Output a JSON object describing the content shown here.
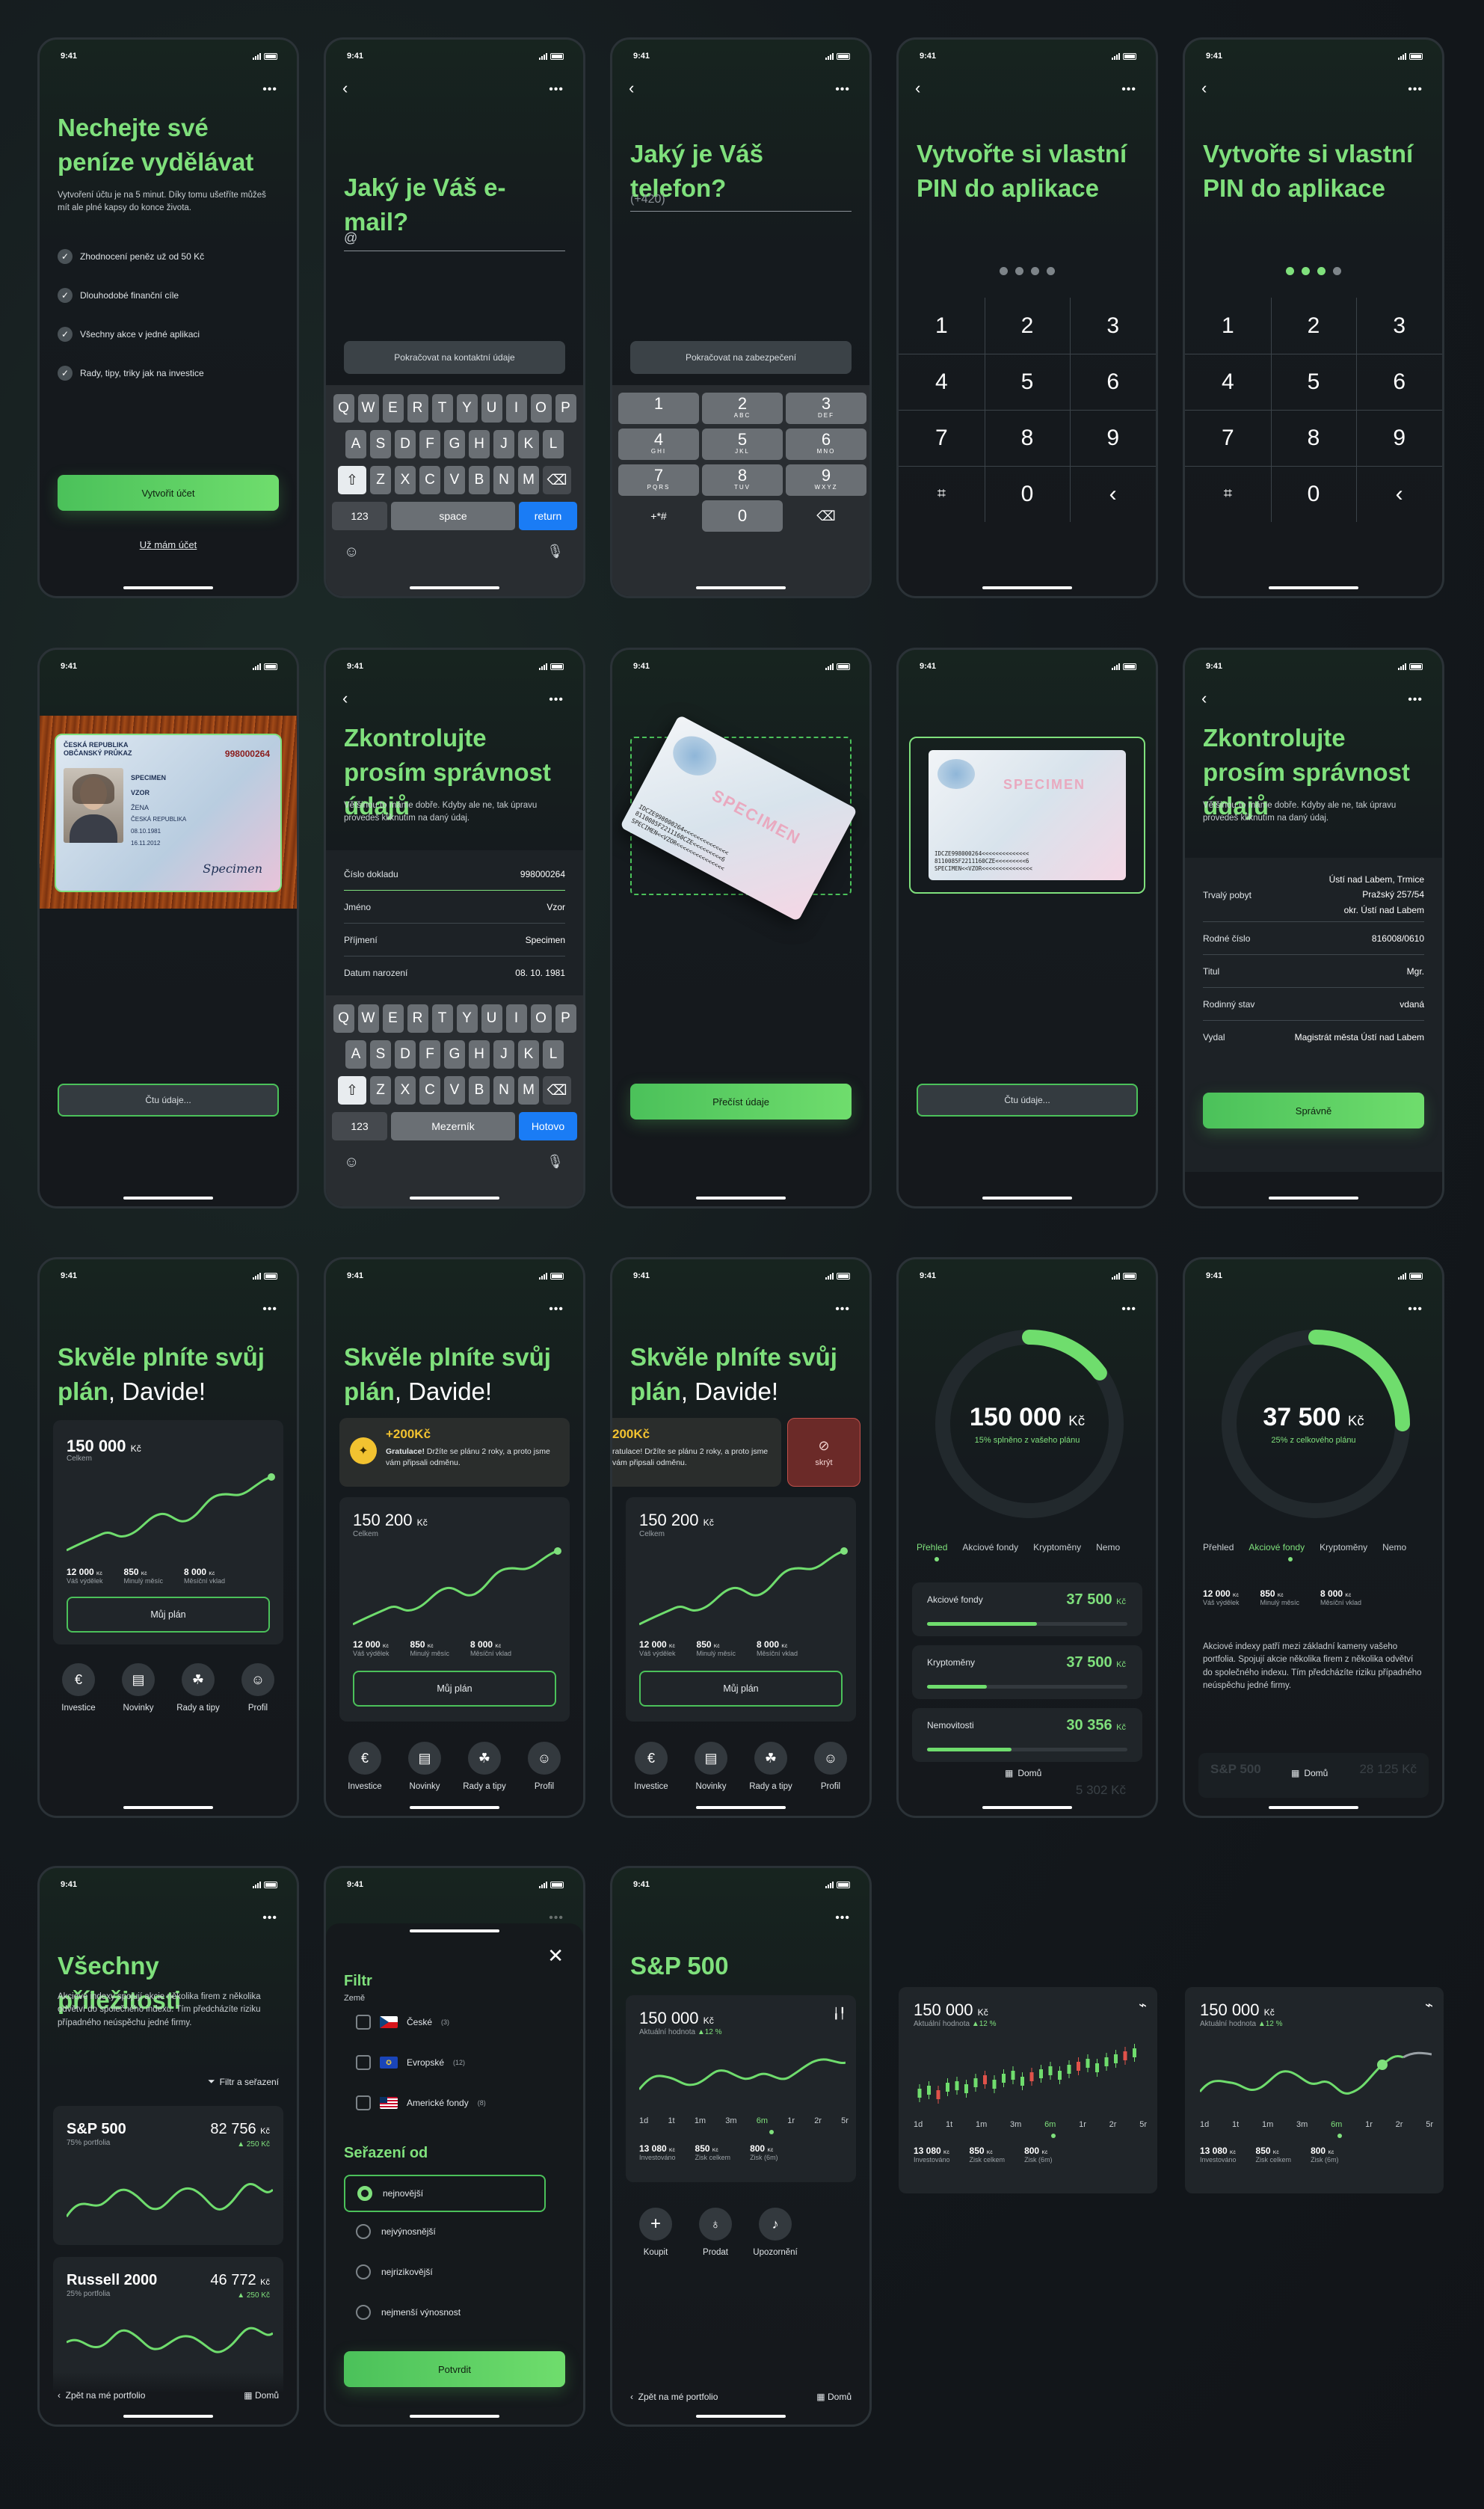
{
  "status_time": "9:41",
  "s1": {
    "title": "Nechejte své peníze vydělávat",
    "subtitle": "Vytvoření účtu je na 5 minut. Díky tomu ušetříte můžeš mít ale plné kapsy do konce života.",
    "bullets": [
      "Zhodnocení peněz už od 50 Kč",
      "Dlouhodobé finanční cíle",
      "Všechny akce v jedné aplikaci",
      "Rady, tipy, triky jak na investice"
    ],
    "primary": "Vytvořit účet",
    "secondary": "Už mám účet"
  },
  "s2": {
    "title": "Jaký je Váš e-mail?",
    "input_prefix": "@",
    "button": "Pokračovat na kontaktní údaje",
    "kb_row1": [
      "Q",
      "W",
      "E",
      "R",
      "T",
      "Y",
      "U",
      "I",
      "O",
      "P"
    ],
    "kb_row2": [
      "A",
      "S",
      "D",
      "F",
      "G",
      "H",
      "J",
      "K",
      "L"
    ],
    "kb_row3": [
      "Z",
      "X",
      "C",
      "V",
      "B",
      "N",
      "M"
    ],
    "kb_123": "123",
    "kb_space": "space",
    "kb_return": "return"
  },
  "s3": {
    "title": "Jaký je Váš telefon?",
    "prefix": "(+420)",
    "button": "Pokračovat na zabezpečení",
    "keys": [
      {
        "n": "1",
        "l": ""
      },
      {
        "n": "2",
        "l": "ABC"
      },
      {
        "n": "3",
        "l": "DEF"
      },
      {
        "n": "4",
        "l": "GHI"
      },
      {
        "n": "5",
        "l": "JKL"
      },
      {
        "n": "6",
        "l": "MNO"
      },
      {
        "n": "7",
        "l": "PQRS"
      },
      {
        "n": "8",
        "l": "TUV"
      },
      {
        "n": "9",
        "l": "WXYZ"
      }
    ],
    "sym": "+*#",
    "zero": "0"
  },
  "s4": {
    "title": "Vytvořte si vlastní PIN do aplikace"
  },
  "s5": {
    "title": "Vytvořte si vlastní PIN do aplikace"
  },
  "pin_keys": [
    "1",
    "2",
    "3",
    "4",
    "5",
    "6",
    "7",
    "8",
    "9",
    "",
    "0",
    "‹"
  ],
  "id_card": {
    "header1": "ČESKÁ REPUBLIKA",
    "header2": "OBČANSKÝ PRŮKAZ",
    "header3": "CZECH REPUBLIC   IDENTIFICATION CARD",
    "number": "998000264",
    "surname": "SPECIMEN",
    "name": "VZOR",
    "sex": "ŽENA",
    "nationality": "ČESKÁ REPUBLIKA",
    "birth": "08.10.1981",
    "issued": "16.11.2012"
  },
  "s6": {
    "button": "Čtu údaje..."
  },
  "s7": {
    "title": "Zkontrolujte prosím správnost údajů",
    "subtitle": "Většinou to máme dobře. Kdyby ale ne, tak úpravu provedeš kliknutím na daný údaj.",
    "fields": [
      {
        "k": "Číslo dokladu",
        "v": "998000264"
      },
      {
        "k": "Jméno",
        "v": "Vzor"
      },
      {
        "k": "Příjmení",
        "v": "Specimen"
      },
      {
        "k": "Datum narození",
        "v": "08. 10. 1981"
      }
    ],
    "kb_mid": "Mezerník",
    "kb_done": "Hotovo"
  },
  "s8": {
    "button": "Přečíst údaje",
    "specimen": "SPECIMEN"
  },
  "mrz": [
    "IDCZE998000264<<<<<<<<<<<<<<",
    "8110085F2211160CZE<<<<<<<<<6",
    "SPECIMEN<<VZOR<<<<<<<<<<<<<<<"
  ],
  "s9": {
    "button": "Čtu údaje..."
  },
  "s10": {
    "title": "Zkontrolujte prosím správnost údajů",
    "subtitle": "Většinou to máme dobře. Kdyby ale ne, tak úpravu provedeš kliknutím na daný údaj.",
    "address_k": "Trvalý pobyt",
    "address_v": [
      "Ústí nad Labem, Trmice",
      "Pražský 257/54",
      "okr. Ústí nad Labem"
    ],
    "fields": [
      {
        "k": "Rodné číslo",
        "v": "816008/0610"
      },
      {
        "k": "Titul",
        "v": "Mgr."
      },
      {
        "k": "Rodinný stav",
        "v": "vdaná"
      },
      {
        "k": "Vydal",
        "v": "Magistrát města Ústí nad Labem"
      }
    ],
    "button": "Správně"
  },
  "plan": {
    "title_g": "Skvěle plníte svůj plán",
    "title_w": ", Davide!",
    "amount1": "150 000",
    "amount2": "150 200",
    "currency": "Kč",
    "total_label": "Celkem",
    "stats": [
      {
        "v": "12 000",
        "u": "Kč",
        "l": "Váš výdělek"
      },
      {
        "v": "850",
        "u": "Kč",
        "l": "Minulý měsíc"
      },
      {
        "v": "8 000",
        "u": "Kč",
        "l": "Měsíční vklad"
      }
    ],
    "plan_btn": "Můj plán",
    "nav": [
      "Investice",
      "Novinky",
      "Rady a tipy",
      "Profil"
    ],
    "reward_title": "+200Kč",
    "reward_text_b": "Gratulace!",
    "reward_text": " Držíte se plánu 2 roky, a proto jsme vám připsali odměnu.",
    "reward_partial": "200Kč",
    "reward_partial_text": "ratulace! Držíte se plánu 2 roky, a proto jsme vám připsali odměnu.",
    "hide": "skrýt"
  },
  "port1": {
    "big": "150 000",
    "cur": "Kč",
    "caption": "15% splněno z vašeho plánu",
    "tabs": [
      "Přehled",
      "Akciové fondy",
      "Kryptoměny",
      "Nemo"
    ],
    "rows": [
      {
        "k": "Akciové fondy",
        "v": "37 500",
        "fill": 0.55
      },
      {
        "k": "Kryptoměny",
        "v": "37 500",
        "fill": 0.3
      },
      {
        "k": "Nemovitosti",
        "v": "30 356",
        "fill": 0.42
      }
    ],
    "home": "Domů",
    "faded": "5 302 Kč"
  },
  "port2": {
    "big": "37 500",
    "cur": "Kč",
    "caption": "25% z celkového plánu",
    "tabs": [
      "Přehled",
      "Akciové fondy",
      "Kryptoměny",
      "Nemo"
    ],
    "stats": [
      {
        "v": "12 000",
        "u": "Kč",
        "l": "Váš výdělek"
      },
      {
        "v": "850",
        "u": "Kč",
        "l": "Minulý měsíc"
      },
      {
        "v": "8 000",
        "u": "Kč",
        "l": "Měsíční vklad"
      }
    ],
    "text": "Akciové indexy patří mezi základní kameny vašeho portfolia. Spojují akcie několika firem z několika odvětví do společného indexu. Tím předcházíte riziku případného neúspěchu jedné firmy.",
    "faded_l": "S&P 500",
    "faded_r": "28 125 Kč",
    "home": "Domů"
  },
  "opp": {
    "title": "Všechny příležitosti",
    "text": "Akciové indexy spojují akcie několika firem z několika odvětví do společného indexu. Tím předcházíte riziku případného neúspěchu jedné firmy.",
    "filter": "Filtr a seřazení",
    "cards": [
      {
        "name": "S&P 500",
        "share": "75% portfolia",
        "value": "82 756",
        "cur": "Kč",
        "chg": "▲ 250 Kč"
      },
      {
        "name": "Russell 2000",
        "share": "25% portfolia",
        "value": "46 772",
        "cur": "Kč",
        "chg": "▲ 250 Kč"
      }
    ],
    "back": "Zpět na mé portfolio",
    "home": "Domů"
  },
  "filter": {
    "title": "Filtr",
    "group1": "Země",
    "countries": [
      {
        "name": "České",
        "count": "(3)"
      },
      {
        "name": "Evropské",
        "count": "(12)"
      },
      {
        "name": "Americké fondy",
        "count": "(8)"
      }
    ],
    "sort_title": "Seřazení od",
    "sorts": [
      "nejnovější",
      "nejvýnosnější",
      "nejrizikovější",
      "nejmenší výnosnost"
    ],
    "button": "Potvrdit"
  },
  "sp": {
    "title": "S&P 500",
    "value": "150 000",
    "cur": "Kč",
    "label": "Aktuální hodnota",
    "chg": "▲12 %",
    "periods": [
      "1d",
      "1t",
      "1m",
      "3m",
      "6m",
      "1r",
      "2r",
      "5r"
    ],
    "active_period": "6m",
    "stats": [
      {
        "v": "13 080",
        "u": "Kč",
        "l": "Investováno"
      },
      {
        "v": "850",
        "u": "Kč",
        "l": "Zisk celkem"
      },
      {
        "v": "800",
        "u": "Kč",
        "l": "Zisk (6m)"
      }
    ],
    "actions": [
      "Koupit",
      "Prodat",
      "Upozornění"
    ],
    "back": "Zpět na mé portfolio",
    "home": "Domů"
  }
}
